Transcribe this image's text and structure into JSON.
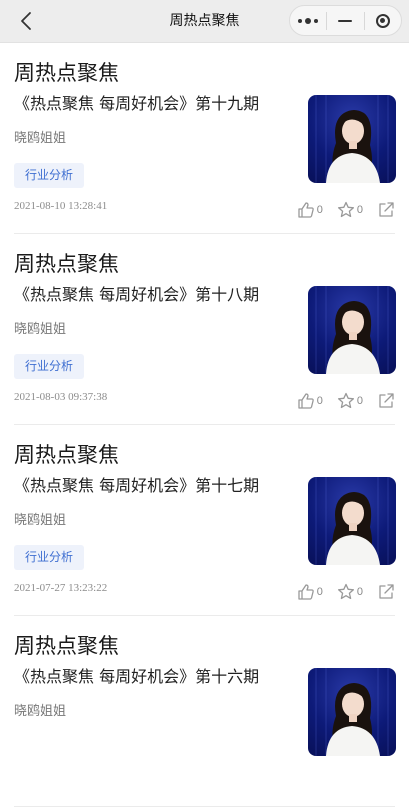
{
  "navbar": {
    "title": "周热点聚焦",
    "back_icon": "chevron-left-icon",
    "capsule_icons": [
      "more-dots-icon",
      "minimize-icon",
      "close-target-icon"
    ]
  },
  "feed": [
    {
      "title": "周热点聚焦",
      "subtitle": "《热点聚焦 每周好机会》第十九期",
      "author": "晓鸥姐姐",
      "tag": "行业分析",
      "date": "2021-08-10 13:28:41",
      "likes": "0",
      "favorites": "0"
    },
    {
      "title": "周热点聚焦",
      "subtitle": "《热点聚焦 每周好机会》第十八期",
      "author": "晓鸥姐姐",
      "tag": "行业分析",
      "date": "2021-08-03 09:37:38",
      "likes": "0",
      "favorites": "0"
    },
    {
      "title": "周热点聚焦",
      "subtitle": "《热点聚焦 每周好机会》第十七期",
      "author": "晓鸥姐姐",
      "tag": "行业分析",
      "date": "2021-07-27 13:23:22",
      "likes": "0",
      "favorites": "0"
    },
    {
      "title": "周热点聚焦",
      "subtitle": "《热点聚焦 每周好机会》第十六期",
      "author": "晓鸥姐姐",
      "tag": "",
      "date": "",
      "likes": "",
      "favorites": ""
    }
  ],
  "colors": {
    "navbar_bg": "#ededed",
    "tag_bg": "#eef2fb",
    "tag_text": "#3f6fd1",
    "thumb_bg": "#0d1a78"
  }
}
